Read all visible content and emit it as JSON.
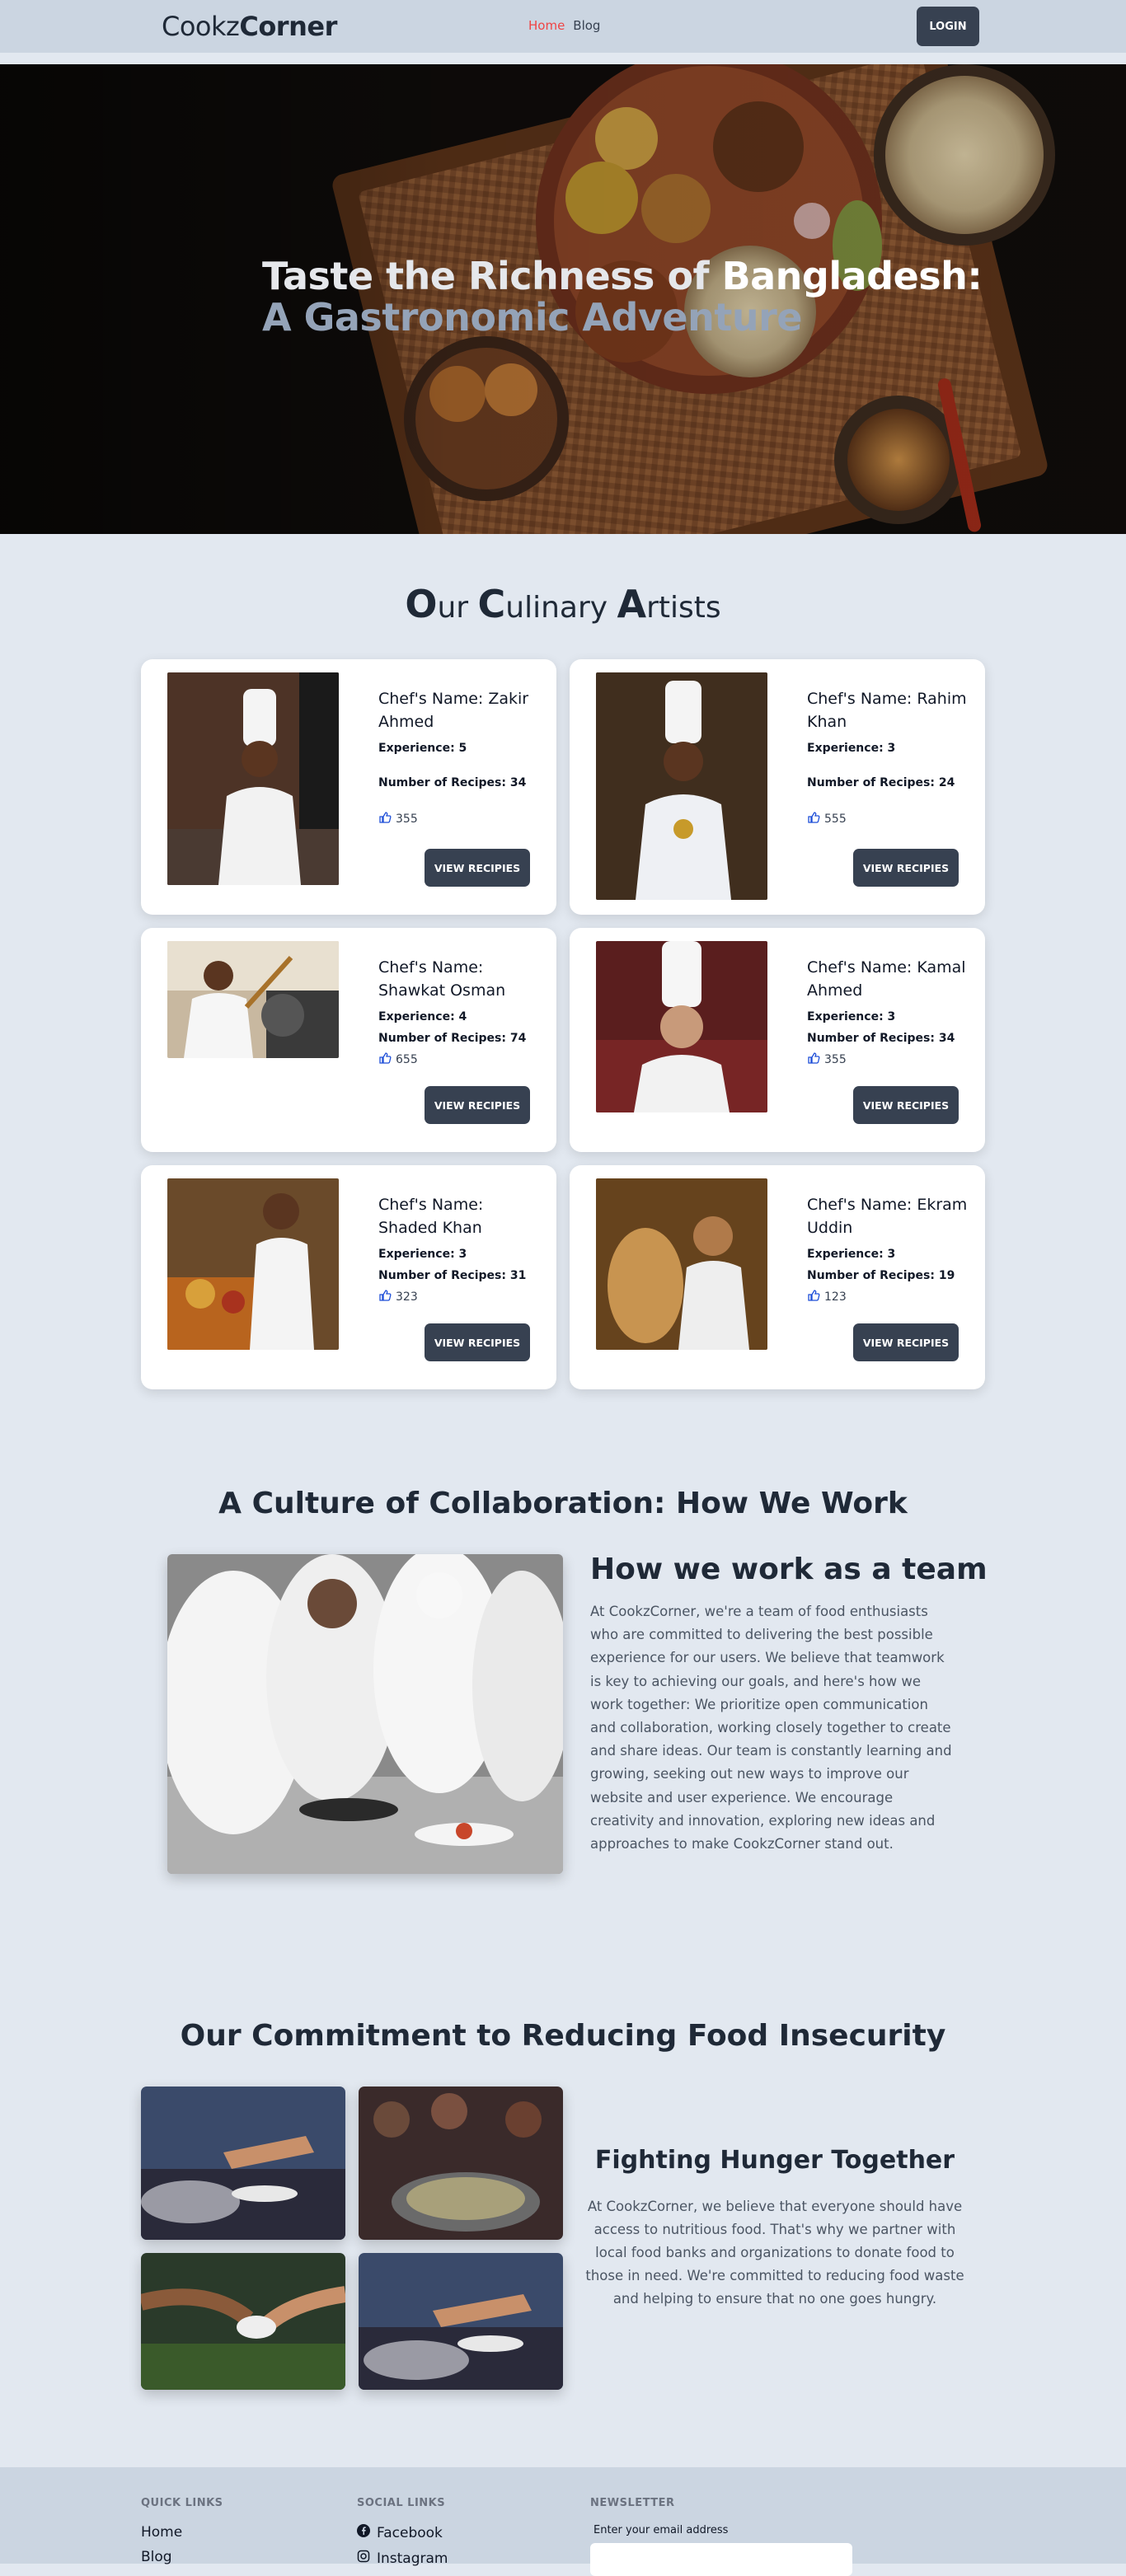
{
  "nav": {
    "brand_part1": "Cookz",
    "brand_part2": "Corner",
    "links": [
      "Home",
      "Blog"
    ],
    "login_label": "LOGIN"
  },
  "hero": {
    "line1_part1": "Taste the Richness of ",
    "line1_part2": "Bangladesh:",
    "line2": "A Gastronomic Adventure"
  },
  "artists": {
    "title_words": [
      {
        "cap": "O",
        "rest": "ur "
      },
      {
        "cap": "C",
        "rest": "ulinary "
      },
      {
        "cap": "A",
        "rest": "rtists"
      }
    ],
    "chefs": [
      {
        "name": "Chef's Name: Zakir Ahmed",
        "experience": "Experience: 5",
        "recipes": "Number of Recipes: 34",
        "likes": "355",
        "button": "VIEW RECIPIES"
      },
      {
        "name": "Chef's Name: Rahim Khan",
        "experience": "Experience: 3",
        "recipes": "Number of Recipes: 24",
        "likes": "555",
        "button": "VIEW RECIPIES"
      },
      {
        "name": "Chef's Name: Shawkat Osman",
        "experience": "Experience: 4",
        "recipes": "Number of Recipes: 74",
        "likes": "655",
        "button": "VIEW RECIPIES"
      },
      {
        "name": "Chef's Name: Kamal Ahmed",
        "experience": "Experience: 3",
        "recipes": "Number of Recipes: 34",
        "likes": "355",
        "button": "VIEW RECIPIES"
      },
      {
        "name": "Chef's Name: Shaded Khan",
        "experience": "Experience: 3",
        "recipes": "Number of Recipes: 31",
        "likes": "323",
        "button": "VIEW RECIPIES"
      },
      {
        "name": "Chef's Name: Ekram Uddin",
        "experience": "Experience: 3",
        "recipes": "Number of Recipes: 19",
        "likes": "123",
        "button": "VIEW RECIPIES"
      }
    ]
  },
  "collab": {
    "title": "A Culture of Collaboration: How We Work",
    "heading": "How we work as a team",
    "text": "At CookzCorner, we're a team of food enthusiasts who are committed to delivering the best possible experience for our users. We believe that teamwork is key to achieving our goals, and here's how we work together: We prioritize open communication and collaboration, working closely together to create and share ideas. Our team is constantly learning and growing, seeking out new ways to improve our website and user experience. We encourage creativity and innovation, exploring new ideas and approaches to make CookzCorner stand out."
  },
  "hunger": {
    "title": "Our Commitment to Reducing Food Insecurity",
    "heading": "Fighting Hunger Together",
    "text": "At CookzCorner, we believe that everyone should have access to nutritious food. That's why we partner with local food banks and organizations to donate food to those in need. We're committed to reducing food waste and helping to ensure that no one goes hungry."
  },
  "footer": {
    "quick_links_head": "QUICK LINKS",
    "quick_links": [
      "Home",
      "Blog"
    ],
    "social_head": "SOCIAL LINKS",
    "social_links": [
      "Facebook",
      "Instagram"
    ],
    "newsletter_head": "NEWSLETTER",
    "email_label": "Enter your email address"
  }
}
